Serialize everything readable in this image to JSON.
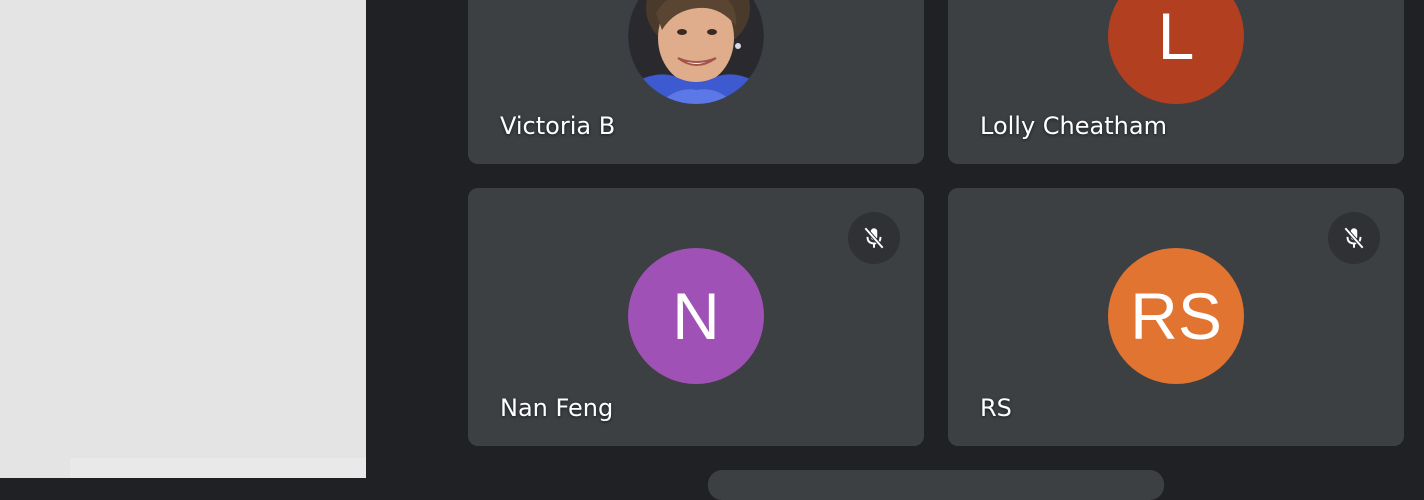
{
  "participants": [
    {
      "name": "Victoria B",
      "initials": "",
      "avatar_type": "photo",
      "avatar_color": "#3f4d8f",
      "muted": false
    },
    {
      "name": "Lolly Cheatham",
      "initials": "L",
      "avatar_type": "initials",
      "avatar_color": "#b23f1f",
      "muted": false
    },
    {
      "name": "Nan Feng",
      "initials": "N",
      "avatar_type": "initials",
      "avatar_color": "#a051b6",
      "muted": true,
      "mic_icon": "mic-off-icon"
    },
    {
      "name": "RS",
      "initials": "RS",
      "avatar_type": "initials",
      "avatar_color": "#e07430",
      "muted": true,
      "mic_icon": "mic-off-icon"
    }
  ],
  "colors": {
    "stage_background": "#202124",
    "tile_background": "#3c4043",
    "left_panel_background": "#e4e4e4"
  }
}
